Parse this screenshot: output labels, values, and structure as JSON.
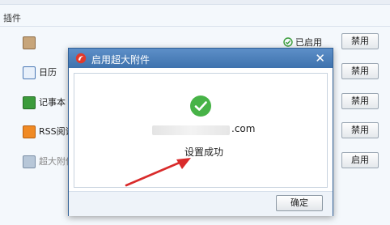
{
  "section": {
    "title": "插件"
  },
  "plugins": [
    {
      "name": "",
      "status": "已启用",
      "button": "禁用"
    },
    {
      "name": "日历",
      "button": "禁用"
    },
    {
      "name": "记事本",
      "button": "禁用"
    },
    {
      "name": "RSS阅读",
      "button": "禁用"
    },
    {
      "name": "超大附件",
      "button": "启用"
    }
  ],
  "dialog": {
    "title": "启用超大附件",
    "close": "✕",
    "email_suffix": ".com",
    "message": "设置成功",
    "ok_button": "确定"
  },
  "colors": {
    "dialog_title_bar": "#4a7fbd",
    "success_green": "#47b347",
    "arrow_red": "#d92b2b"
  }
}
